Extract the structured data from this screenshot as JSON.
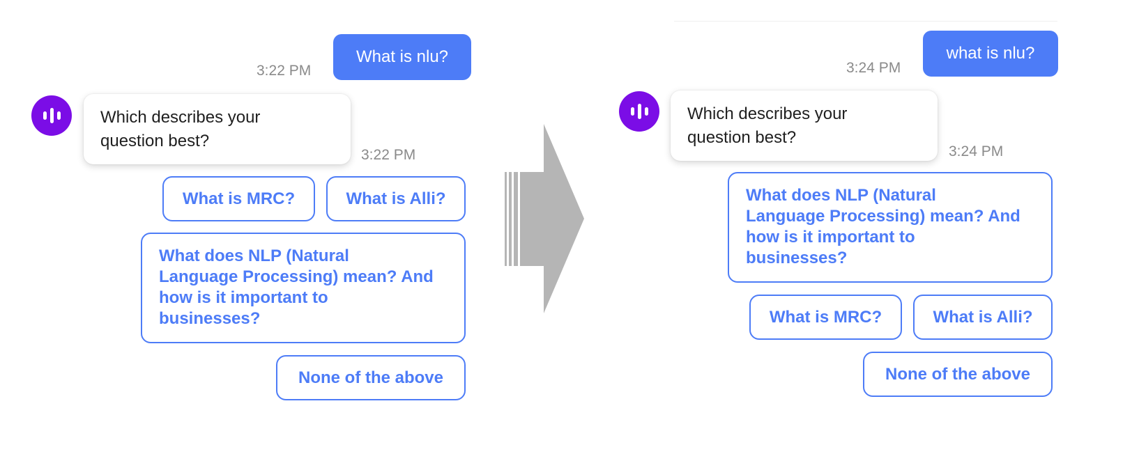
{
  "colors": {
    "accent": "#4d7cf7",
    "avatar": "#7b0de6",
    "arrow": "#b5b5b5",
    "timestamp": "#8a8a8a"
  },
  "before": {
    "user_message": "What is nlu?",
    "user_time": "3:22 PM",
    "bot_avatar_icon": "audio-wave-icon",
    "bot_message_lines": [
      "Which describes your",
      "question best?"
    ],
    "bot_time": "3:22 PM",
    "options": {
      "mrc": "What is MRC?",
      "alli": "What is Alli?",
      "nlp_lines": [
        "What does NLP (Natural",
        "Language Processing) mean? And",
        "how is it important to",
        "businesses?"
      ],
      "none": "None of the above"
    }
  },
  "after": {
    "user_message": "what is nlu?",
    "user_time": "3:24 PM",
    "bot_avatar_icon": "audio-wave-icon",
    "bot_message_lines": [
      "Which describes your",
      "question best?"
    ],
    "bot_time": "3:24 PM",
    "options": {
      "nlp_lines": [
        "What does NLP (Natural",
        "Language Processing) mean? And",
        "how is it important to",
        "businesses?"
      ],
      "mrc": "What is MRC?",
      "alli": "What is Alli?",
      "none": "None of the above"
    }
  },
  "transition_icon": "right-arrow-icon"
}
